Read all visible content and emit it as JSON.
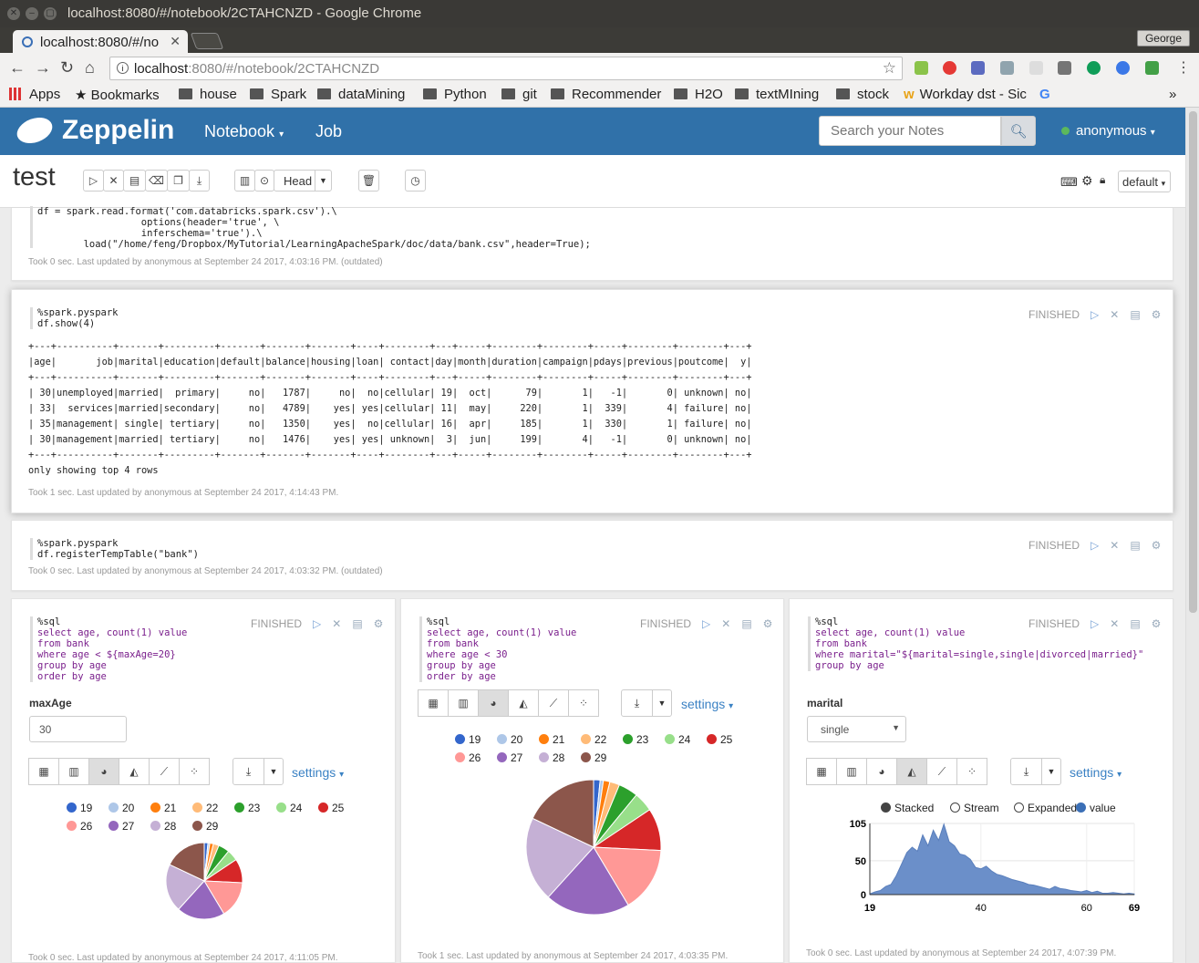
{
  "window": {
    "title": "localhost:8080/#/notebook/2CTAHCNZD - Google Chrome",
    "tab_label": "localhost:8080/#/no",
    "user_chip": "George"
  },
  "omnibox": {
    "host": "localhost",
    "rest": ":8080/#/notebook/2CTAHCNZD"
  },
  "bookmarks": [
    {
      "label": "Apps"
    },
    {
      "label": "Bookmarks"
    },
    {
      "label": "house"
    },
    {
      "label": "Spark"
    },
    {
      "label": "dataMining"
    },
    {
      "label": "Python"
    },
    {
      "label": "git"
    },
    {
      "label": "Recommender"
    },
    {
      "label": "H2O"
    },
    {
      "label": "textMIning"
    },
    {
      "label": "stock"
    },
    {
      "label": "Workday dst - Sic"
    }
  ],
  "zeppelin": {
    "brand": "Zeppelin",
    "nav_notebook": "Notebook",
    "nav_job": "Job",
    "search_placeholder": "Search your Notes",
    "user": "anonymous"
  },
  "notebook": {
    "title": "test",
    "head_label": "Head",
    "interpreter_default": "default"
  },
  "colors": {
    "navbar": "#3071a9",
    "link": "#3b82c4",
    "area": "#6b8fc9"
  },
  "paragraphs": {
    "p1": {
      "code": [
        "df = spark.read.format('com.databricks.spark.csv').\\",
        "                  options(header='true', \\",
        "                  inferschema='true').\\",
        "        load(\"/home/feng/Dropbox/MyTutorial/LearningApacheSpark/doc/data/bank.csv\",header=True);"
      ],
      "meta": "Took 0 sec. Last updated by anonymous at September 24 2017, 4:03:16 PM. (outdated)"
    },
    "p2": {
      "status": "FINISHED",
      "code": [
        "%spark.pyspark",
        "df.show(4)"
      ],
      "output": [
        "+---+----------+-------+---------+-------+-------+-------+----+--------+---+-----+--------+--------+-----+--------+--------+---+",
        "|age|       job|marital|education|default|balance|housing|loan| contact|day|month|duration|campaign|pdays|previous|poutcome|  y|",
        "+---+----------+-------+---------+-------+-------+-------+----+--------+---+-----+--------+--------+-----+--------+--------+---+",
        "| 30|unemployed|married|  primary|     no|   1787|     no|  no|cellular| 19|  oct|      79|       1|   -1|       0| unknown| no|",
        "| 33|  services|married|secondary|     no|   4789|    yes| yes|cellular| 11|  may|     220|       1|  339|       4| failure| no|",
        "| 35|management| single| tertiary|     no|   1350|    yes|  no|cellular| 16|  apr|     185|       1|  330|       1| failure| no|",
        "| 30|management|married| tertiary|     no|   1476|    yes| yes| unknown|  3|  jun|     199|       4|   -1|       0| unknown| no|",
        "+---+----------+-------+---------+-------+-------+-------+----+--------+---+-----+--------+--------+-----+--------+--------+---+",
        "",
        "only showing top 4 rows"
      ],
      "meta": "Took 1 sec. Last updated by anonymous at September 24 2017, 4:14:43 PM."
    },
    "p3": {
      "status": "FINISHED",
      "code": [
        "%spark.pyspark",
        "df.registerTempTable(\"bank\")"
      ],
      "meta": "Took 0 sec. Last updated by anonymous at September 24 2017, 4:03:32 PM. (outdated)"
    },
    "p4": {
      "status": "FINISHED",
      "code": [
        "%sql",
        "select age, count(1) value",
        "from bank",
        "where age < ${maxAge=20}",
        "group by age",
        "order by age"
      ],
      "form_label": "maxAge",
      "form_value": "30",
      "settings": "settings",
      "meta": "Took 0 sec. Last updated by anonymous at September 24 2017, 4:11:05 PM."
    },
    "p5": {
      "status": "FINISHED",
      "code": [
        "%sql",
        "select age, count(1) value",
        "from bank",
        "where age < 30",
        "group by age",
        "order by age"
      ],
      "settings": "settings",
      "meta": "Took 1 sec. Last updated by anonymous at September 24 2017, 4:03:35 PM."
    },
    "p6": {
      "status": "FINISHED",
      "code": [
        "%sql",
        "select age, count(1) value",
        "from bank",
        "where marital=\"${marital=single,single|divorced|married}\"",
        "group by age"
      ],
      "form_label": "marital",
      "form_value": "single",
      "settings": "settings",
      "meta": "Took 0 sec. Last updated by anonymous at September 24 2017, 4:07:39 PM."
    }
  },
  "chart_data": [
    {
      "type": "pie",
      "categories": [
        "19",
        "20",
        "21",
        "22",
        "23",
        "24",
        "25",
        "26",
        "27",
        "28",
        "29"
      ],
      "values": [
        2,
        1,
        2,
        3,
        6,
        6,
        13,
        20,
        26,
        26,
        23
      ],
      "colors": [
        "#3366cc",
        "#aec7e8",
        "#ff7f0e",
        "#ffbb78",
        "#2ca02c",
        "#98df8a",
        "#d62728",
        "#ff9896",
        "#9467bd",
        "#c5b0d5",
        "#8c564b"
      ]
    },
    {
      "type": "pie",
      "categories": [
        "19",
        "20",
        "21",
        "22",
        "23",
        "24",
        "25",
        "26",
        "27",
        "28",
        "29"
      ],
      "values": [
        2,
        1,
        2,
        3,
        6,
        6,
        13,
        20,
        26,
        26,
        23
      ],
      "colors": [
        "#3366cc",
        "#aec7e8",
        "#ff7f0e",
        "#ffbb78",
        "#2ca02c",
        "#98df8a",
        "#d62728",
        "#ff9896",
        "#9467bd",
        "#c5b0d5",
        "#8c564b"
      ]
    },
    {
      "type": "area",
      "controls": [
        "Stacked",
        "Stream",
        "Expanded"
      ],
      "series": [
        {
          "name": "value"
        }
      ],
      "x": [
        19,
        20,
        21,
        22,
        23,
        24,
        25,
        26,
        27,
        28,
        29,
        30,
        31,
        32,
        33,
        34,
        35,
        36,
        37,
        38,
        39,
        40,
        41,
        42,
        43,
        44,
        45,
        46,
        47,
        48,
        49,
        50,
        51,
        52,
        53,
        54,
        55,
        56,
        57,
        58,
        59,
        60,
        61,
        62,
        63,
        64,
        65,
        66,
        67,
        68,
        69
      ],
      "y": [
        1,
        4,
        6,
        12,
        15,
        28,
        45,
        62,
        70,
        64,
        88,
        72,
        95,
        80,
        104,
        78,
        72,
        60,
        58,
        52,
        40,
        38,
        42,
        35,
        30,
        28,
        25,
        22,
        20,
        18,
        15,
        14,
        12,
        10,
        8,
        12,
        9,
        8,
        6,
        5,
        4,
        6,
        3,
        5,
        2,
        2,
        3,
        2,
        1,
        2,
        1
      ],
      "xticks": [
        "19",
        "40",
        "60",
        "69"
      ],
      "yticks": [
        "0",
        "50",
        "105"
      ],
      "ylim": [
        0,
        105
      ],
      "xlim": [
        19,
        69
      ]
    }
  ]
}
